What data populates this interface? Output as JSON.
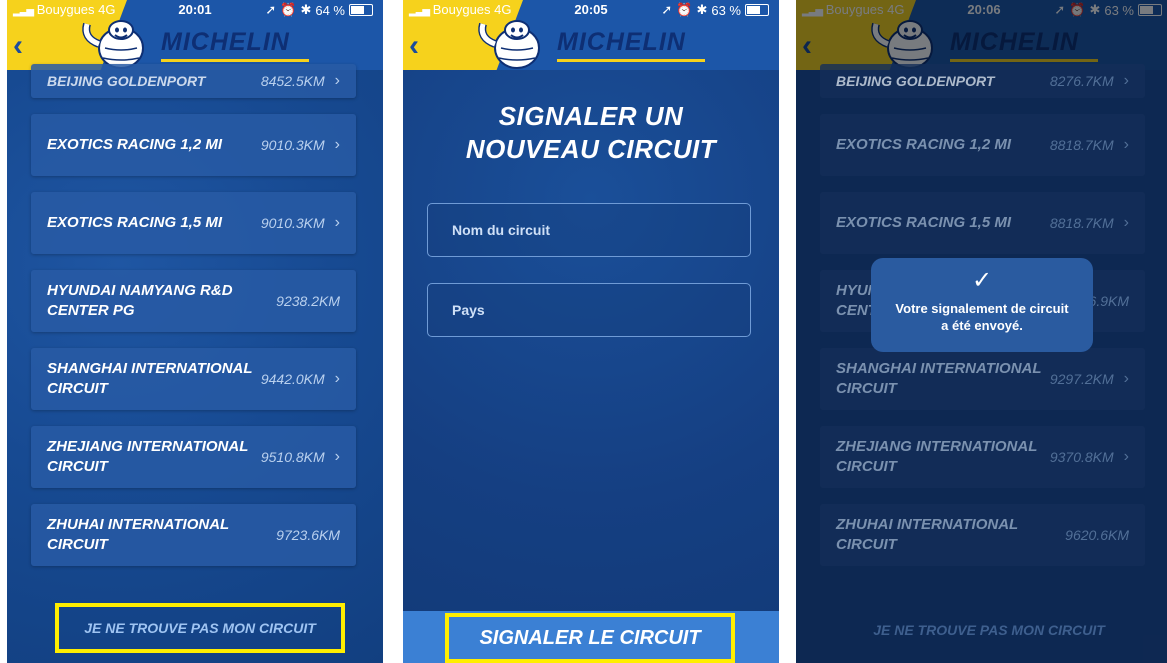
{
  "screens": [
    {
      "status": {
        "carrier": "Bouygues",
        "network": "4G",
        "time": "20:01",
        "battery": "64 %"
      },
      "brand": "MICHELIN",
      "partial_item": {
        "name": "BEIJING GOLDENPORT",
        "distance": "8452.5KM"
      },
      "items": [
        {
          "name": "EXOTICS RACING 1,2 MI",
          "distance": "9010.3KM"
        },
        {
          "name": "EXOTICS RACING 1,5 MI",
          "distance": "9010.3KM"
        },
        {
          "name": "HYUNDAI NAMYANG R&D CENTER PG",
          "distance": "9238.2KM"
        },
        {
          "name": "SHANGHAI INTERNATIONAL CIRCUIT",
          "distance": "9442.0KM"
        },
        {
          "name": "ZHEJIANG INTERNATIONAL CIRCUIT",
          "distance": "9510.8KM"
        },
        {
          "name": "ZHUHAI INTERNATIONAL CIRCUIT",
          "distance": "9723.6KM"
        }
      ],
      "cta": "JE NE TROUVE PAS MON CIRCUIT"
    },
    {
      "status": {
        "carrier": "Bouygues",
        "network": "4G",
        "time": "20:05",
        "battery": "63 %"
      },
      "brand": "MICHELIN",
      "title_line1": "SIGNALER UN",
      "title_line2": "NOUVEAU CIRCUIT",
      "fields": [
        {
          "placeholder": "Nom du circuit",
          "value": ""
        },
        {
          "placeholder": "Pays",
          "value": ""
        }
      ],
      "submit": "SIGNALER LE CIRCUIT"
    },
    {
      "status": {
        "carrier": "Bouygues",
        "network": "4G",
        "time": "20:06",
        "battery": "63 %"
      },
      "brand": "MICHELIN",
      "partial_item": {
        "name": "BEIJING GOLDENPORT",
        "distance": "8276.7KM"
      },
      "items": [
        {
          "name": "EXOTICS RACING 1,2 MI",
          "distance": "8818.7KM"
        },
        {
          "name": "EXOTICS RACING 1,5 MI",
          "distance": "8818.7KM"
        },
        {
          "name": "HYUNDAI NAMYANG R&D CENTER PG",
          "distance": "9046.9KM"
        },
        {
          "name": "SHANGHAI INTERNATIONAL CIRCUIT",
          "distance": "9297.2KM"
        },
        {
          "name": "ZHEJIANG INTERNATIONAL CIRCUIT",
          "distance": "9370.8KM"
        },
        {
          "name": "ZHUHAI INTERNATIONAL CIRCUIT",
          "distance": "9620.6KM"
        }
      ],
      "toast": {
        "check": "✓",
        "line1": "Votre signalement de circuit",
        "line2": "a été envoyé."
      },
      "cta": "JE NE TROUVE PAS MON CIRCUIT"
    }
  ],
  "colors": {
    "accent_yellow": "#f6d21c",
    "highlight_border": "#ffee00",
    "brand_blue": "#0e2f74"
  }
}
